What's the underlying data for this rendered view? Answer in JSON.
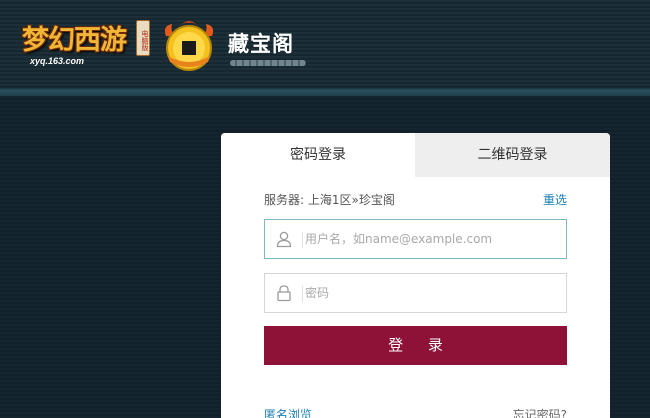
{
  "header": {
    "game_logo": {
      "title": "梦幻西游",
      "tag": "电脑版",
      "url": "xyq.163.com"
    },
    "site_logo": {
      "title": "藏宝阁",
      "icon": "coin-icon"
    }
  },
  "login": {
    "tabs": [
      {
        "label": "密码登录",
        "active": true
      },
      {
        "label": "二维码登录",
        "active": false
      }
    ],
    "server": {
      "label": "服务器: 上海1区»珍宝阁",
      "reselect": "重选"
    },
    "username": {
      "placeholder": "用户名，如name@example.com",
      "icon": "user-icon"
    },
    "password": {
      "placeholder": "密码",
      "icon": "lock-icon"
    },
    "submit_label": "登 录",
    "anonymous_link": "匿名浏览",
    "forgot_link": "忘记密码?"
  },
  "colors": {
    "accent": "#8e1237",
    "link": "#1a7fb5",
    "header_bg": "#1d2f38"
  }
}
